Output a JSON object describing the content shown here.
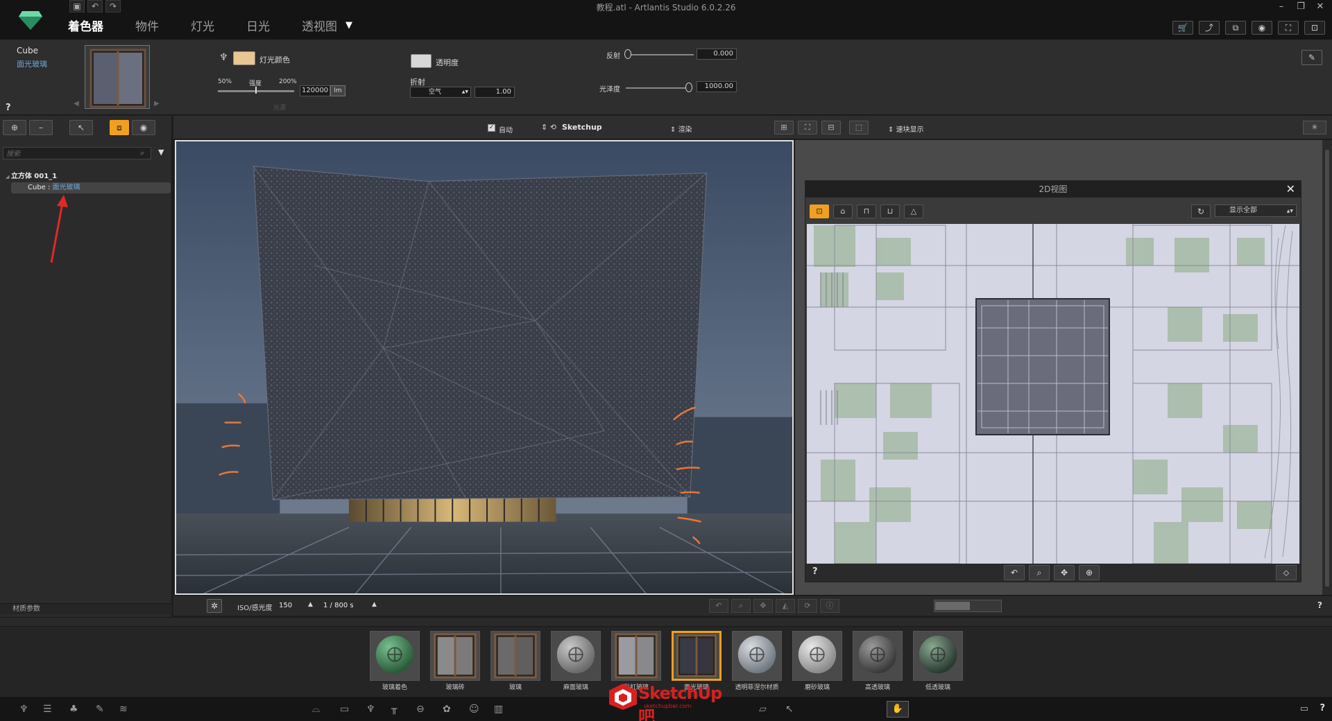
{
  "window": {
    "title": "教程.atl - Artlantis Studio 6.0.2.26"
  },
  "tabs": [
    {
      "label": "着色器",
      "active": true
    },
    {
      "label": "物件",
      "active": false
    },
    {
      "label": "灯光",
      "active": false
    },
    {
      "label": "日光",
      "active": false
    },
    {
      "label": "透视图",
      "active": false
    }
  ],
  "properties": {
    "object_name": "Cube",
    "material_name": "面光玻璃",
    "help": "?",
    "light_color_label": "灯光颜色",
    "light_color": "#e8c890",
    "intensity": {
      "min_label": "50%",
      "label": "强度",
      "max_label": "200%",
      "value": "120000",
      "unit": "lm"
    },
    "faint_label": "光源",
    "transparency_label": "透明度",
    "transparency_color": "#d8d8d8",
    "refraction_label": "折射",
    "refraction_medium": "空气",
    "refraction_value": "1.00",
    "reflection_label": "反射",
    "reflection_value": "0.000",
    "gloss_label": "光泽度",
    "gloss_value": "1000.00"
  },
  "tree": {
    "search_placeholder": "搜索",
    "root": "立方体 001_1",
    "selected_object": "Cube : ",
    "selected_material": "面光玻璃",
    "footer": "材质参数"
  },
  "viewport_toolbar": {
    "auto_label": "自动",
    "auto_checked": true,
    "source_label": "Sketchup",
    "render_label": "渲染",
    "fast_label": "速块显示"
  },
  "view2d": {
    "title": "2D视图",
    "display_option": "显示全部",
    "help": "?"
  },
  "camera": {
    "iso_label": "ISO/感光度",
    "iso_value": "150",
    "shutter_value": "1 / 800 s",
    "help": "?"
  },
  "catalog": [
    {
      "label": "玻璃着色",
      "selected": false,
      "kind": "sphere-green"
    },
    {
      "label": "玻璃砖",
      "selected": false,
      "kind": "window-pattern"
    },
    {
      "label": "玻璃",
      "selected": false,
      "kind": "window-plain"
    },
    {
      "label": "麻面玻璃",
      "selected": false,
      "kind": "sphere-grey"
    },
    {
      "label": "彩虹玻璃",
      "selected": false,
      "kind": "window-light"
    },
    {
      "label": "面光玻璃",
      "selected": true,
      "kind": "window-dark"
    },
    {
      "label": "透明菲涅尔材质",
      "selected": false,
      "kind": "sphere-clear"
    },
    {
      "label": "磨砂玻璃",
      "selected": false,
      "kind": "sphere-frost"
    },
    {
      "label": "高透玻璃",
      "selected": false,
      "kind": "sphere-dark"
    },
    {
      "label": "低透玻璃",
      "selected": false,
      "kind": "sphere-darkgreen"
    }
  ],
  "watermark": {
    "text": "SketchUp吧",
    "sub": "sketchupbar.com"
  },
  "colors": {
    "accent": "#f0a020",
    "link": "#6fa8d8"
  }
}
